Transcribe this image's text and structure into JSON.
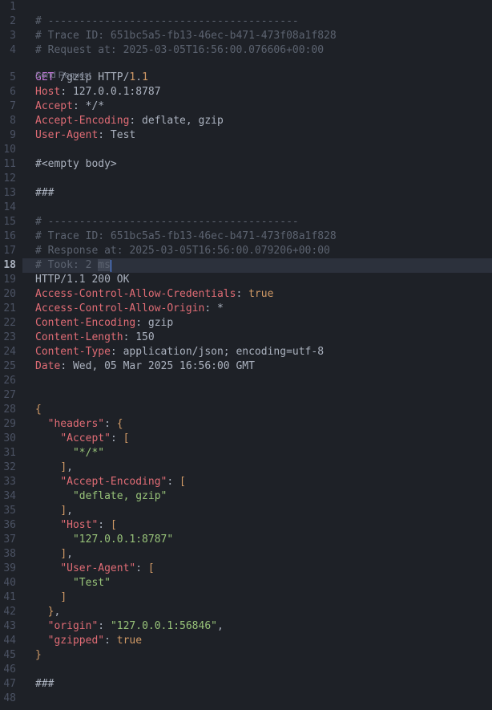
{
  "codeLens": {
    "sendRequest": "Send Request"
  },
  "activeLine": 18,
  "lines": {
    "1": "",
    "2": {
      "comment": "# ----------------------------------------"
    },
    "3": {
      "comment": "# Trace ID: 651bc5a5-fb13-46ec-b471-473f08a1f828"
    },
    "4": {
      "comment": "# Request at: 2025-03-05T16:56:00.076606+00:00"
    },
    "5": {
      "method": "GET",
      "path": " /gzip HTTP/",
      "v1": "1",
      "dot": ".",
      "v2": "1"
    },
    "6": {
      "h": "Host",
      "c": ":",
      "v": " 127.0.0.1:8787"
    },
    "7": {
      "h": "Accept",
      "c": ":",
      "v": " */*"
    },
    "8": {
      "h": "Accept-Encoding",
      "c": ":",
      "v": " deflate, gzip"
    },
    "9": {
      "h": "User-Agent",
      "c": ":",
      "v": " Test"
    },
    "10": "",
    "11": {
      "plain": "#<empty body>"
    },
    "12": "",
    "13": {
      "plain": "###"
    },
    "14": "",
    "15": {
      "comment": "# ----------------------------------------"
    },
    "16": {
      "comment": "# Trace ID: 651bc5a5-fb13-46ec-b471-473f08a1f828"
    },
    "17": {
      "comment": "# Response at: 2025-03-05T16:56:00.079206+00:00"
    },
    "18": {
      "prefix": "# Took: 2 ",
      "sel": "ms"
    },
    "19": {
      "proto": "HTTP/1.1",
      "rest": " 200 OK"
    },
    "20": {
      "h": "Access-Control-Allow-Credentials",
      "c": ":",
      "v": " true",
      "bool": true
    },
    "21": {
      "h": "Access-Control-Allow-Origin",
      "c": ":",
      "v": " *"
    },
    "22": {
      "h": "Content-Encoding",
      "c": ":",
      "v": " gzip"
    },
    "23": {
      "h": "Content-Length",
      "c": ":",
      "v": " 150"
    },
    "24": {
      "h": "Content-Type",
      "c": ":",
      "v": " application/json; encoding=utf-8"
    },
    "25": {
      "h": "Date",
      "c": ":",
      "v": " Wed, 05 Mar 2025 16:56:00 GMT"
    },
    "26": "",
    "27": "",
    "28": {
      "brace": "{"
    },
    "29": {
      "indent": "  ",
      "key": "\"headers\"",
      "after": ": {",
      "braceColor": true
    },
    "30": {
      "indent": "    ",
      "key": "\"Accept\"",
      "after": ": [",
      "bracketColor": true
    },
    "31": {
      "indent": "      ",
      "str": "\"*/*\""
    },
    "32": {
      "indent": "    ",
      "bracket": "]",
      "comma": ","
    },
    "33": {
      "indent": "    ",
      "key": "\"Accept-Encoding\"",
      "after": ": [",
      "bracketColor": true
    },
    "34": {
      "indent": "      ",
      "str": "\"deflate, gzip\""
    },
    "35": {
      "indent": "    ",
      "bracket": "]",
      "comma": ","
    },
    "36": {
      "indent": "    ",
      "key": "\"Host\"",
      "after": ": [",
      "bracketColor": true
    },
    "37": {
      "indent": "      ",
      "str": "\"127.0.0.1:8787\""
    },
    "38": {
      "indent": "    ",
      "bracket": "]",
      "comma": ","
    },
    "39": {
      "indent": "    ",
      "key": "\"User-Agent\"",
      "after": ": [",
      "bracketColor": true
    },
    "40": {
      "indent": "      ",
      "str": "\"Test\""
    },
    "41": {
      "indent": "    ",
      "bracket": "]"
    },
    "42": {
      "indent": "  ",
      "brace": "}",
      "comma": ","
    },
    "43": {
      "indent": "  ",
      "key": "\"origin\"",
      "colon": ": ",
      "str": "\"127.0.0.1:56846\"",
      "comma": ","
    },
    "44": {
      "indent": "  ",
      "key": "\"gzipped\"",
      "colon": ": ",
      "bool": "true"
    },
    "45": {
      "brace": "}"
    },
    "46": "",
    "47": {
      "plain": "###"
    },
    "48": ""
  }
}
